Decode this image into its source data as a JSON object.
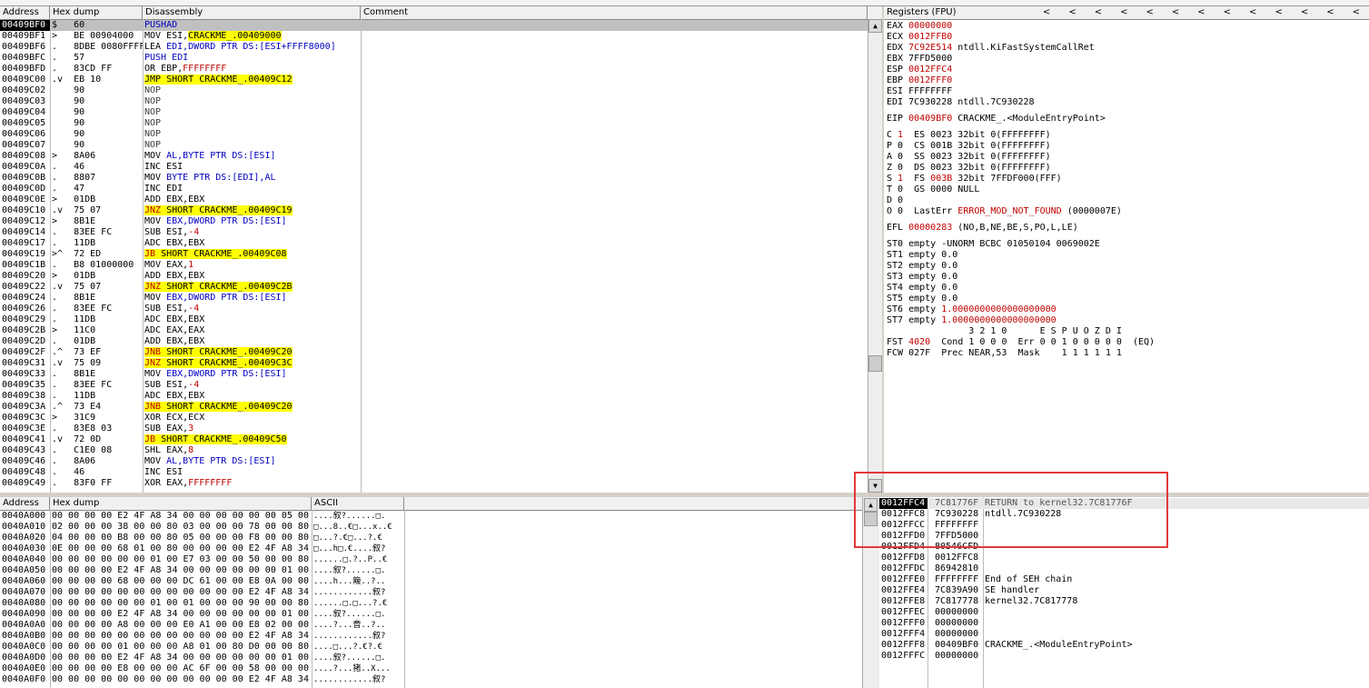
{
  "cpu_headers": {
    "address": "Address",
    "hex": "Hex dump",
    "disasm": "Disassembly",
    "comment": "Comment"
  },
  "registers_header": "Registers (FPU)",
  "registers_nav": [
    "<",
    "<",
    "<",
    "<",
    "<",
    "<",
    "<",
    "<",
    "<",
    "<",
    "<",
    "<",
    "<"
  ],
  "dump_headers": {
    "address": "Address",
    "hex": "Hex dump",
    "ascii": "ASCII"
  },
  "disasm_rows": [
    {
      "a": "00409BF0",
      "m": "$",
      "h": "60",
      "d": "PUSHAD"
    },
    {
      "a": "00409BF1",
      "m": ">",
      "h": "BE 00904000",
      "d": "MOV ESI,CRACKME_.00409000"
    },
    {
      "a": "00409BF6",
      "m": ".",
      "h": "8DBE 0080FFFF",
      "d": "LEA EDI,DWORD PTR DS:[ESI+FFFF8000]"
    },
    {
      "a": "00409BFC",
      "m": ".",
      "h": "57",
      "d": "PUSH EDI"
    },
    {
      "a": "00409BFD",
      "m": ".",
      "h": "83CD FF",
      "d": "OR EBP,FFFFFFFF"
    },
    {
      "a": "00409C00",
      "m": ".v",
      "h": "EB 10",
      "d": "JMP SHORT CRACKME_.00409C12"
    },
    {
      "a": "00409C02",
      "m": "",
      "h": "90",
      "d": "NOP"
    },
    {
      "a": "00409C03",
      "m": "",
      "h": "90",
      "d": "NOP"
    },
    {
      "a": "00409C04",
      "m": "",
      "h": "90",
      "d": "NOP"
    },
    {
      "a": "00409C05",
      "m": "",
      "h": "90",
      "d": "NOP"
    },
    {
      "a": "00409C06",
      "m": "",
      "h": "90",
      "d": "NOP"
    },
    {
      "a": "00409C07",
      "m": "",
      "h": "90",
      "d": "NOP"
    },
    {
      "a": "00409C08",
      "m": ">",
      "h": "8A06",
      "d": "MOV AL,BYTE PTR DS:[ESI]"
    },
    {
      "a": "00409C0A",
      "m": ".",
      "h": "46",
      "d": "INC ESI"
    },
    {
      "a": "00409C0B",
      "m": ".",
      "h": "8807",
      "d": "MOV BYTE PTR DS:[EDI],AL"
    },
    {
      "a": "00409C0D",
      "m": ".",
      "h": "47",
      "d": "INC EDI"
    },
    {
      "a": "00409C0E",
      "m": ">",
      "h": "01DB",
      "d": "ADD EBX,EBX"
    },
    {
      "a": "00409C10",
      "m": ".v",
      "h": "75 07",
      "d": "JNZ SHORT CRACKME_.00409C19"
    },
    {
      "a": "00409C12",
      "m": ">",
      "h": "8B1E",
      "d": "MOV EBX,DWORD PTR DS:[ESI]"
    },
    {
      "a": "00409C14",
      "m": ".",
      "h": "83EE FC",
      "d": "SUB ESI,-4"
    },
    {
      "a": "00409C17",
      "m": ".",
      "h": "11DB",
      "d": "ADC EBX,EBX"
    },
    {
      "a": "00409C19",
      "m": ">^",
      "h": "72 ED",
      "d": "JB SHORT CRACKME_.00409C08"
    },
    {
      "a": "00409C1B",
      "m": ".",
      "h": "B8 01000000",
      "d": "MOV EAX,1"
    },
    {
      "a": "00409C20",
      "m": ">",
      "h": "01DB",
      "d": "ADD EBX,EBX"
    },
    {
      "a": "00409C22",
      "m": ".v",
      "h": "75 07",
      "d": "JNZ SHORT CRACKME_.00409C2B"
    },
    {
      "a": "00409C24",
      "m": ".",
      "h": "8B1E",
      "d": "MOV EBX,DWORD PTR DS:[ESI]"
    },
    {
      "a": "00409C26",
      "m": ".",
      "h": "83EE FC",
      "d": "SUB ESI,-4"
    },
    {
      "a": "00409C29",
      "m": ".",
      "h": "11DB",
      "d": "ADC EBX,EBX"
    },
    {
      "a": "00409C2B",
      "m": ">",
      "h": "11C0",
      "d": "ADC EAX,EAX"
    },
    {
      "a": "00409C2D",
      "m": ".",
      "h": "01DB",
      "d": "ADD EBX,EBX"
    },
    {
      "a": "00409C2F",
      "m": ".^",
      "h": "73 EF",
      "d": "JNB SHORT CRACKME_.00409C20"
    },
    {
      "a": "00409C31",
      "m": ".v",
      "h": "75 09",
      "d": "JNZ SHORT CRACKME_.00409C3C"
    },
    {
      "a": "00409C33",
      "m": ".",
      "h": "8B1E",
      "d": "MOV EBX,DWORD PTR DS:[ESI]"
    },
    {
      "a": "00409C35",
      "m": ".",
      "h": "83EE FC",
      "d": "SUB ESI,-4"
    },
    {
      "a": "00409C38",
      "m": ".",
      "h": "11DB",
      "d": "ADC EBX,EBX"
    },
    {
      "a": "00409C3A",
      "m": ".^",
      "h": "73 E4",
      "d": "JNB SHORT CRACKME_.00409C20"
    },
    {
      "a": "00409C3C",
      "m": ">",
      "h": "31C9",
      "d": "XOR ECX,ECX"
    },
    {
      "a": "00409C3E",
      "m": ".",
      "h": "83E8 03",
      "d": "SUB EAX,3"
    },
    {
      "a": "00409C41",
      "m": ".v",
      "h": "72 0D",
      "d": "JB SHORT CRACKME_.00409C50"
    },
    {
      "a": "00409C43",
      "m": ".",
      "h": "C1E0 08",
      "d": "SHL EAX,8"
    },
    {
      "a": "00409C46",
      "m": ".",
      "h": "8A06",
      "d": "MOV AL,BYTE PTR DS:[ESI]"
    },
    {
      "a": "00409C48",
      "m": ".",
      "h": "46",
      "d": "INC ESI"
    },
    {
      "a": "00409C49",
      "m": ".",
      "h": "83F0 FF",
      "d": "XOR EAX,FFFFFFFF"
    }
  ],
  "registers": [
    "EAX 00000000",
    "ECX 0012FFB0",
    "EDX 7C92E514 ntdll.KiFastSystemCallRet",
    "EBX 7FFD5000",
    "ESP 0012FFC4",
    "EBP 0012FFF0",
    "ESI FFFFFFFF",
    "EDI 7C930228 ntdll.7C930228",
    "",
    "EIP 00409BF0 CRACKME_.<ModuleEntryPoint>",
    "",
    "C 1  ES 0023 32bit 0(FFFFFFFF)",
    "P 0  CS 001B 32bit 0(FFFFFFFF)",
    "A 0  SS 0023 32bit 0(FFFFFFFF)",
    "Z 0  DS 0023 32bit 0(FFFFFFFF)",
    "S 1  FS 003B 32bit 7FFDF000(FFF)",
    "T 0  GS 0000 NULL",
    "D 0",
    "O 0  LastErr ERROR_MOD_NOT_FOUND (0000007E)",
    "",
    "EFL 00000283 (NO,B,NE,BE,S,PO,L,LE)",
    "",
    "ST0 empty -UNORM BCBC 01050104 0069002E",
    "ST1 empty 0.0",
    "ST2 empty 0.0",
    "ST3 empty 0.0",
    "ST4 empty 0.0",
    "ST5 empty 0.0",
    "ST6 empty 1.0000000000000000000",
    "ST7 empty 1.0000000000000000000",
    "               3 2 1 0      E S P U O Z D I",
    "FST 4020  Cond 1 0 0 0  Err 0 0 1 0 0 0 0 0  (EQ)",
    "FCW 027F  Prec NEAR,53  Mask    1 1 1 1 1 1"
  ],
  "dump_rows": [
    {
      "a": "0040A000",
      "h": "00 00 00 00 E2 4F A8 34 00 00 00 00 00 00 05 00",
      "s": "....叙?......□."
    },
    {
      "a": "0040A010",
      "h": "02 00 00 00 38 00 00 80 03 00 00 00 78 00 00 80",
      "s": "□...8..€□...x..€"
    },
    {
      "a": "0040A020",
      "h": "04 00 00 00 B8 00 00 80 05 00 00 00 F8 00 00 80",
      "s": "□...?.€□...?.€"
    },
    {
      "a": "0040A030",
      "h": "0E 00 00 00 68 01 00 80 00 00 00 00 E2 4F A8 34",
      "s": "□...h□.€....叙?"
    },
    {
      "a": "0040A040",
      "h": "00 00 00 00 00 00 01 00 E7 03 00 00 50 00 00 80",
      "s": "......□.?..P..€"
    },
    {
      "a": "0040A050",
      "h": "00 00 00 00 E2 4F A8 34 00 00 00 00 00 00 01 00",
      "s": "....叙?......□."
    },
    {
      "a": "0040A060",
      "h": "00 00 00 00 68 00 00 00 DC 61 00 00 E8 0A 00 00",
      "s": "....h...簸..?.."
    },
    {
      "a": "0040A070",
      "h": "00 00 00 00 00 00 00 00 00 00 00 00 E2 4F A8 34",
      "s": "............叙?"
    },
    {
      "a": "0040A080",
      "h": "00 00 00 00 00 00 01 00 01 00 00 00 90 00 00 80",
      "s": "......□.□...?.€"
    },
    {
      "a": "0040A090",
      "h": "00 00 00 00 E2 4F A8 34 00 00 00 00 00 00 01 00",
      "s": "....叙?......□."
    },
    {
      "a": "0040A0A0",
      "h": "00 00 00 00 A8 00 00 00 E0 A1 00 00 E8 02 00 00",
      "s": "....?...啻..?.."
    },
    {
      "a": "0040A0B0",
      "h": "00 00 00 00 00 00 00 00 00 00 00 00 E2 4F A8 34",
      "s": "............叙?"
    },
    {
      "a": "0040A0C0",
      "h": "00 00 00 00 01 00 00 00 A8 01 00 80 D0 00 00 80",
      "s": "....□...?.€?.€"
    },
    {
      "a": "0040A0D0",
      "h": "00 00 00 00 E2 4F A8 34 00 00 00 00 00 00 01 00",
      "s": "....叙?......□."
    },
    {
      "a": "0040A0E0",
      "h": "00 00 00 00 E8 00 00 00 AC 6F 00 00 58 00 00 00",
      "s": "....?...猪..X..."
    },
    {
      "a": "0040A0F0",
      "h": "00 00 00 00 00 00 00 00 00 00 00 00 E2 4F A8 34",
      "s": "............叙?"
    }
  ],
  "stack_rows": [
    {
      "a": "0012FFC4",
      "v": "7C81776F",
      "c": "RETURN to kernel32.7C81776F"
    },
    {
      "a": "0012FFC8",
      "v": "7C930228",
      "c": "ntdll.7C930228"
    },
    {
      "a": "0012FFCC",
      "v": "FFFFFFFF",
      "c": ""
    },
    {
      "a": "0012FFD0",
      "v": "7FFD5000",
      "c": ""
    },
    {
      "a": "0012FFD4",
      "v": "80546CFD",
      "c": ""
    },
    {
      "a": "0012FFD8",
      "v": "0012FFC8",
      "c": ""
    },
    {
      "a": "0012FFDC",
      "v": "86942810",
      "c": ""
    },
    {
      "a": "0012FFE0",
      "v": "FFFFFFFF",
      "c": "End of SEH chain"
    },
    {
      "a": "0012FFE4",
      "v": "7C839A90",
      "c": "SE handler"
    },
    {
      "a": "0012FFE8",
      "v": "7C817778",
      "c": "kernel32.7C817778"
    },
    {
      "a": "0012FFEC",
      "v": "00000000",
      "c": ""
    },
    {
      "a": "0012FFF0",
      "v": "00000000",
      "c": ""
    },
    {
      "a": "0012FFF4",
      "v": "00000000",
      "c": ""
    },
    {
      "a": "0012FFF8",
      "v": "00409BF0",
      "c": "CRACKME_.<ModuleEntryPoint>"
    },
    {
      "a": "0012FFFC",
      "v": "00000000",
      "c": ""
    }
  ],
  "colors": {
    "highlight": "#ffff00",
    "selection": "#000000",
    "changed": "#c00000",
    "annotation": "#e3383a"
  }
}
